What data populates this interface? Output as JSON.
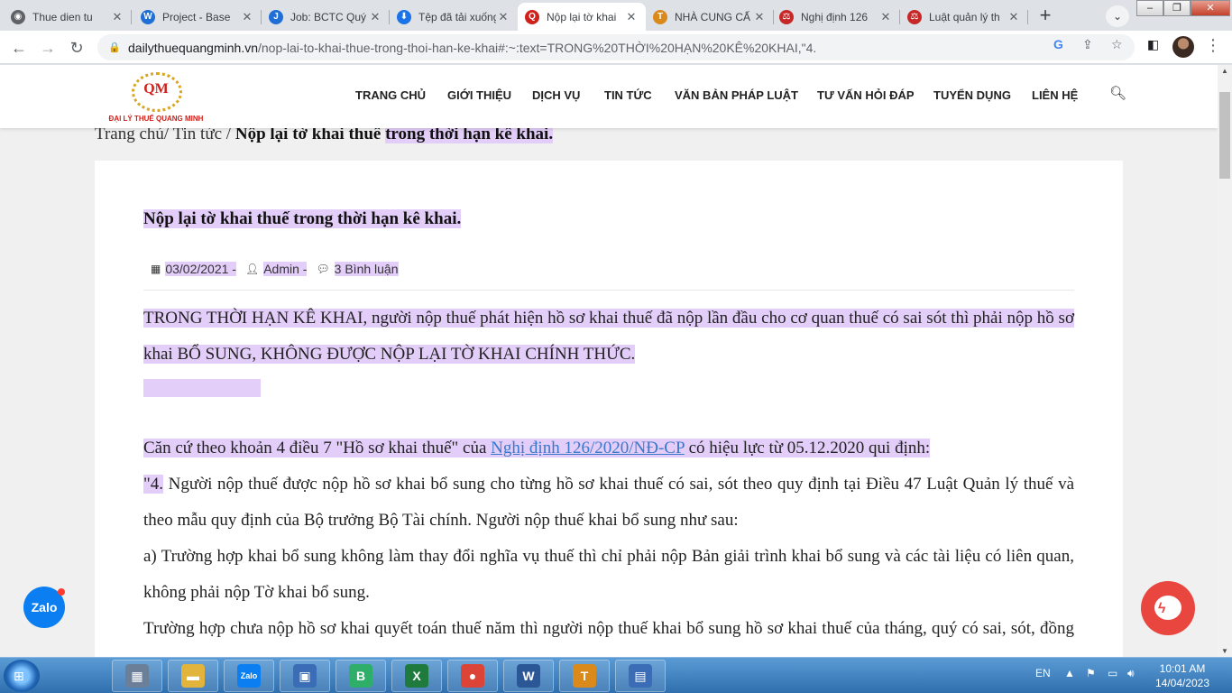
{
  "browser": {
    "tabs": [
      {
        "title": "Thue dien tu",
        "icon": "globe-icon",
        "color": "#5f6368",
        "glyph": "◉"
      },
      {
        "title": "Project - Base",
        "icon": "base-w-icon",
        "color": "#1f6fd6",
        "glyph": "W"
      },
      {
        "title": "Job: BCTC Quý",
        "icon": "base-job-icon",
        "color": "#1f6fd6",
        "glyph": "J"
      },
      {
        "title": "Tệp đã tải xuống",
        "icon": "download-icon",
        "color": "#1a73e8",
        "glyph": "⬇"
      },
      {
        "title": "Nộp lại tờ khai",
        "icon": "qm-favicon-icon",
        "color": "#d0201a",
        "glyph": "Q"
      },
      {
        "title": "NHÀ CUNG CẤ",
        "icon": "supplier-icon",
        "color": "#d98a1a",
        "glyph": "T"
      },
      {
        "title": "Nghị định 126",
        "icon": "law-icon",
        "color": "#c62828",
        "glyph": "⚖"
      },
      {
        "title": "Luật quản lý th",
        "icon": "law-icon-2",
        "color": "#c62828",
        "glyph": "⚖"
      }
    ],
    "active_tab": 4,
    "url_host": "dailythuequangminh.vn",
    "url_path": "/nop-lai-to-khai-thue-trong-thoi-han-ke-khai#:~:text=TRONG%20THỜI%20HẠN%20KÊ%20KHAI,\"4."
  },
  "site": {
    "logo_mark": "QM",
    "logo_name": "ĐẠI LÝ THUẾ QUANG MINH",
    "nav": [
      "TRANG CHỦ",
      "GIỚI THIỆU",
      "DỊCH VỤ",
      "TIN TỨC",
      "VĂN BẢN PHÁP LUẬT",
      "TƯ VẤN HỎI ĐÁP",
      "TUYỂN DỤNG",
      "LIÊN HỆ"
    ]
  },
  "breadcrumb": {
    "home": "Trang chủ/",
    "section": " Tin tức /",
    "current_a": "Nộp lại tờ khai thuế ",
    "current_b": "trong thời hạn kê khai."
  },
  "article": {
    "title": "Nộp lại tờ khai thuế trong thời hạn kê khai.",
    "date": "03/02/2021 -",
    "author": "Admin -",
    "comments": "3 Bình luận",
    "p1": "TRONG THỜI HẠN KÊ KHAI, người nộp thuế phát hiện hồ sơ khai thuế đã nộp lần đầu cho cơ quan thuế có sai sót thì phải nộp hồ sơ khai BỔ SUNG, KHÔNG ĐƯỢC NỘP LẠI TỜ KHAI CHÍNH THỨC.",
    "p2_before": "Căn cứ theo khoản 4 điều 7 \"Hồ sơ khai thuế\" của ",
    "p2_link": "Nghị định 126/2020/NĐ-CP",
    "p2_after": " có hiệu lực từ 05.12.2020 qui định:",
    "p3_hl": "\"4.",
    "p3_rest": " Người nộp thuế được nộp hồ sơ khai bổ sung cho từng hồ sơ khai thuế có sai, sót theo quy định tại Điều 47 Luật Quản lý thuế và theo mẫu quy định của Bộ trưởng Bộ Tài chính. Người nộp thuế khai bổ sung như sau:",
    "p4": "a) Trường hợp khai bổ sung không làm thay đổi nghĩa vụ thuế thì chỉ phải nộp Bản giải trình khai bổ sung và các tài liệu có liên quan, không phải nộp Tờ khai bổ sung.",
    "p5": "Trường hợp chưa nộp hồ sơ khai quyết toán thuế năm thì người nộp thuế khai bổ sung hồ sơ khai thuế của tháng, quý có sai, sót, đồng thời tổng hợp số liệu khai bổ sung vào hồ sơ khai quyết toán thuế năm."
  },
  "widgets": {
    "zalo_label": "Zalo"
  },
  "taskbar": {
    "apps": [
      {
        "name": "calculator-icon",
        "glyph": "▦",
        "color": "#6b7f99"
      },
      {
        "name": "explorer-icon",
        "glyph": "▬",
        "color": "#e3b43c"
      },
      {
        "name": "zalo-app-icon",
        "glyph": "Zalo",
        "color": "#0b7ff1"
      },
      {
        "name": "remote-icon",
        "glyph": "▣",
        "color": "#3a6db5"
      },
      {
        "name": "bkav-icon",
        "glyph": "B",
        "color": "#2fae6a"
      },
      {
        "name": "excel-icon",
        "glyph": "X",
        "color": "#1f7a3e"
      },
      {
        "name": "chrome-icon",
        "glyph": "●",
        "color": "#db4437"
      },
      {
        "name": "word-icon",
        "glyph": "W",
        "color": "#2b5797"
      },
      {
        "name": "htkk-icon",
        "glyph": "T",
        "color": "#d98a1a"
      },
      {
        "name": "spreadsheet-icon",
        "glyph": "▤",
        "color": "#3a6db5"
      }
    ],
    "lang": "EN",
    "time": "10:01 AM",
    "date": "14/04/2023"
  }
}
